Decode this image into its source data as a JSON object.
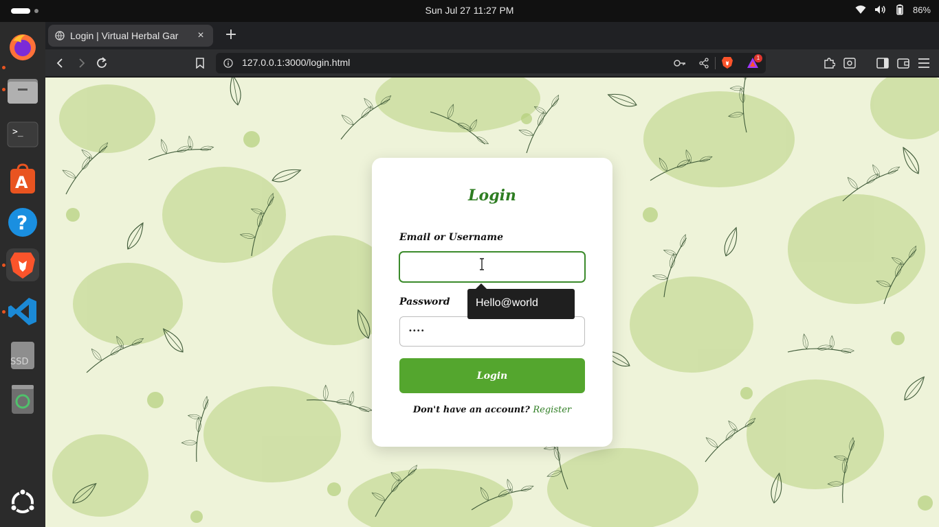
{
  "system": {
    "clock": "Sun Jul 27  11:27 PM",
    "battery": "86%"
  },
  "dock": {
    "apps": [
      "firefox-icon",
      "files-icon",
      "terminal-icon",
      "app-center-icon",
      "help-icon",
      "brave-icon",
      "vscode-icon",
      "ssd-drive-icon",
      "trash-icon"
    ],
    "ssd_label": "SSD"
  },
  "browser": {
    "tab_title": "Login | Virtual Herbal Gar",
    "tab_close": "×",
    "new_tab": "+",
    "url": "127.0.0.1:3000/login.html",
    "notification_count": "1"
  },
  "login": {
    "title": "Login",
    "email_label": "Email or Username",
    "email_value": "",
    "password_label": "Password",
    "password_value": "••••",
    "submit_label": "Login",
    "register_prompt": "Don't have an account?",
    "register_link": "Register",
    "autofill_tooltip": "Hello@world"
  },
  "colors": {
    "accent": "#2e7d22",
    "button": "#54a62e",
    "page_bg": "#eef3d9"
  }
}
